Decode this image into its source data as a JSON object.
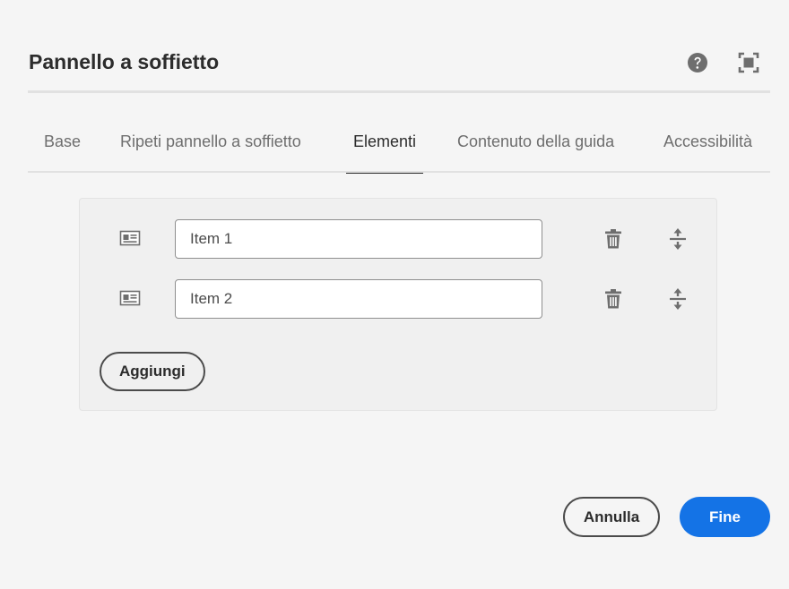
{
  "dialog": {
    "title": "Pannello a soffietto",
    "help_icon": "help-circle-icon",
    "fullscreen_icon": "fullscreen-icon"
  },
  "tabs": [
    {
      "label": "Base",
      "active": false
    },
    {
      "label": "Ripeti pannello a soffietto",
      "active": false
    },
    {
      "label": "Elementi",
      "active": true
    },
    {
      "label": "Contenuto della guida",
      "active": false
    },
    {
      "label": "Accessibilità",
      "active": false
    }
  ],
  "items": [
    {
      "value": "Item 1",
      "icon": "panel-icon",
      "delete_icon": "trash-icon",
      "reorder_icon": "reorder-icon"
    },
    {
      "value": "Item 2",
      "icon": "panel-icon",
      "delete_icon": "trash-icon",
      "reorder_icon": "reorder-icon"
    }
  ],
  "add_label": "Aggiungi",
  "footer": {
    "cancel_label": "Annulla",
    "done_label": "Fine"
  },
  "colors": {
    "accent": "#1473e6",
    "background": "#f5f5f5",
    "text": "#2c2c2c",
    "icon": "#6e6e6e"
  }
}
